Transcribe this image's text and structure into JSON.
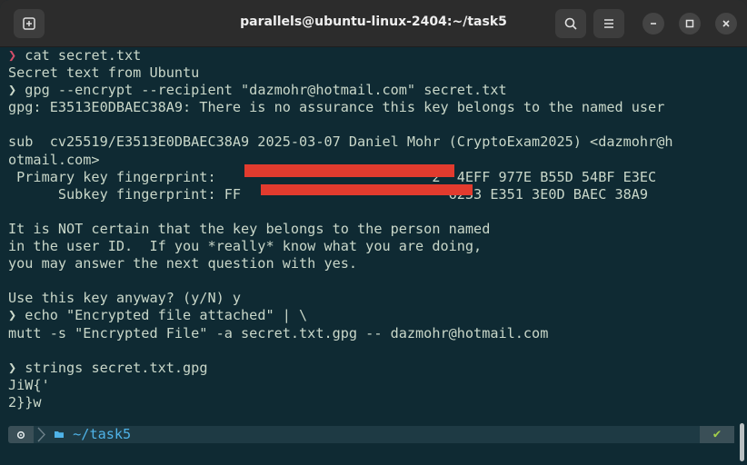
{
  "window": {
    "title": "parallels@ubuntu-linux-2404:~/task5"
  },
  "terminal": {
    "prompt_symbol": "❯",
    "lines": [
      {
        "prompt": true,
        "text": " cat secret.txt"
      },
      {
        "text": "Secret text from Ubuntu"
      },
      {
        "prompt": true,
        "ok": true,
        "text": " gpg --encrypt --recipient \"dazmohr@hotmail.com\" secret.txt"
      },
      {
        "text": "gpg: E3513E0DBAEC38A9: There is no assurance this key belongs to the named user"
      },
      {
        "text": ""
      },
      {
        "text": "sub  cv25519/E3513E0DBAEC38A9 2025-03-07 Daniel Mohr (CryptoExam2025) <dazmohr@h"
      },
      {
        "text": "otmail.com>"
      },
      {
        "text": " Primary key fingerprint:                          2  4EFF 977E B55D 54BF E3EC"
      },
      {
        "text": "      Subkey fingerprint: FF                         6233 E351 3E0D BAEC 38A9"
      },
      {
        "text": ""
      },
      {
        "text": "It is NOT certain that the key belongs to the person named"
      },
      {
        "text": "in the user ID.  If you *really* know what you are doing,"
      },
      {
        "text": "you may answer the next question with yes."
      },
      {
        "text": ""
      },
      {
        "text": "Use this key anyway? (y/N) y"
      },
      {
        "prompt": true,
        "ok": true,
        "text": " echo \"Encrypted file attached\" | \\"
      },
      {
        "text": "mutt -s \"Encrypted File\" -a secret.txt.gpg -- dazmohr@hotmail.com"
      },
      {
        "text": ""
      },
      {
        "prompt": true,
        "ok": true,
        "text": " strings secret.txt.gpg"
      },
      {
        "text": "JiW{'"
      },
      {
        "text": "2}}w"
      }
    ]
  },
  "statusbar": {
    "directory": "~/task5",
    "status_ok": "✔"
  },
  "colors": {
    "background": "#0f2a33",
    "text": "#c9d7c9",
    "prompt_error": "#d24f6a",
    "directory": "#4fb3e8",
    "ok": "#a3cf4a",
    "redaction": "#e23b2e"
  }
}
